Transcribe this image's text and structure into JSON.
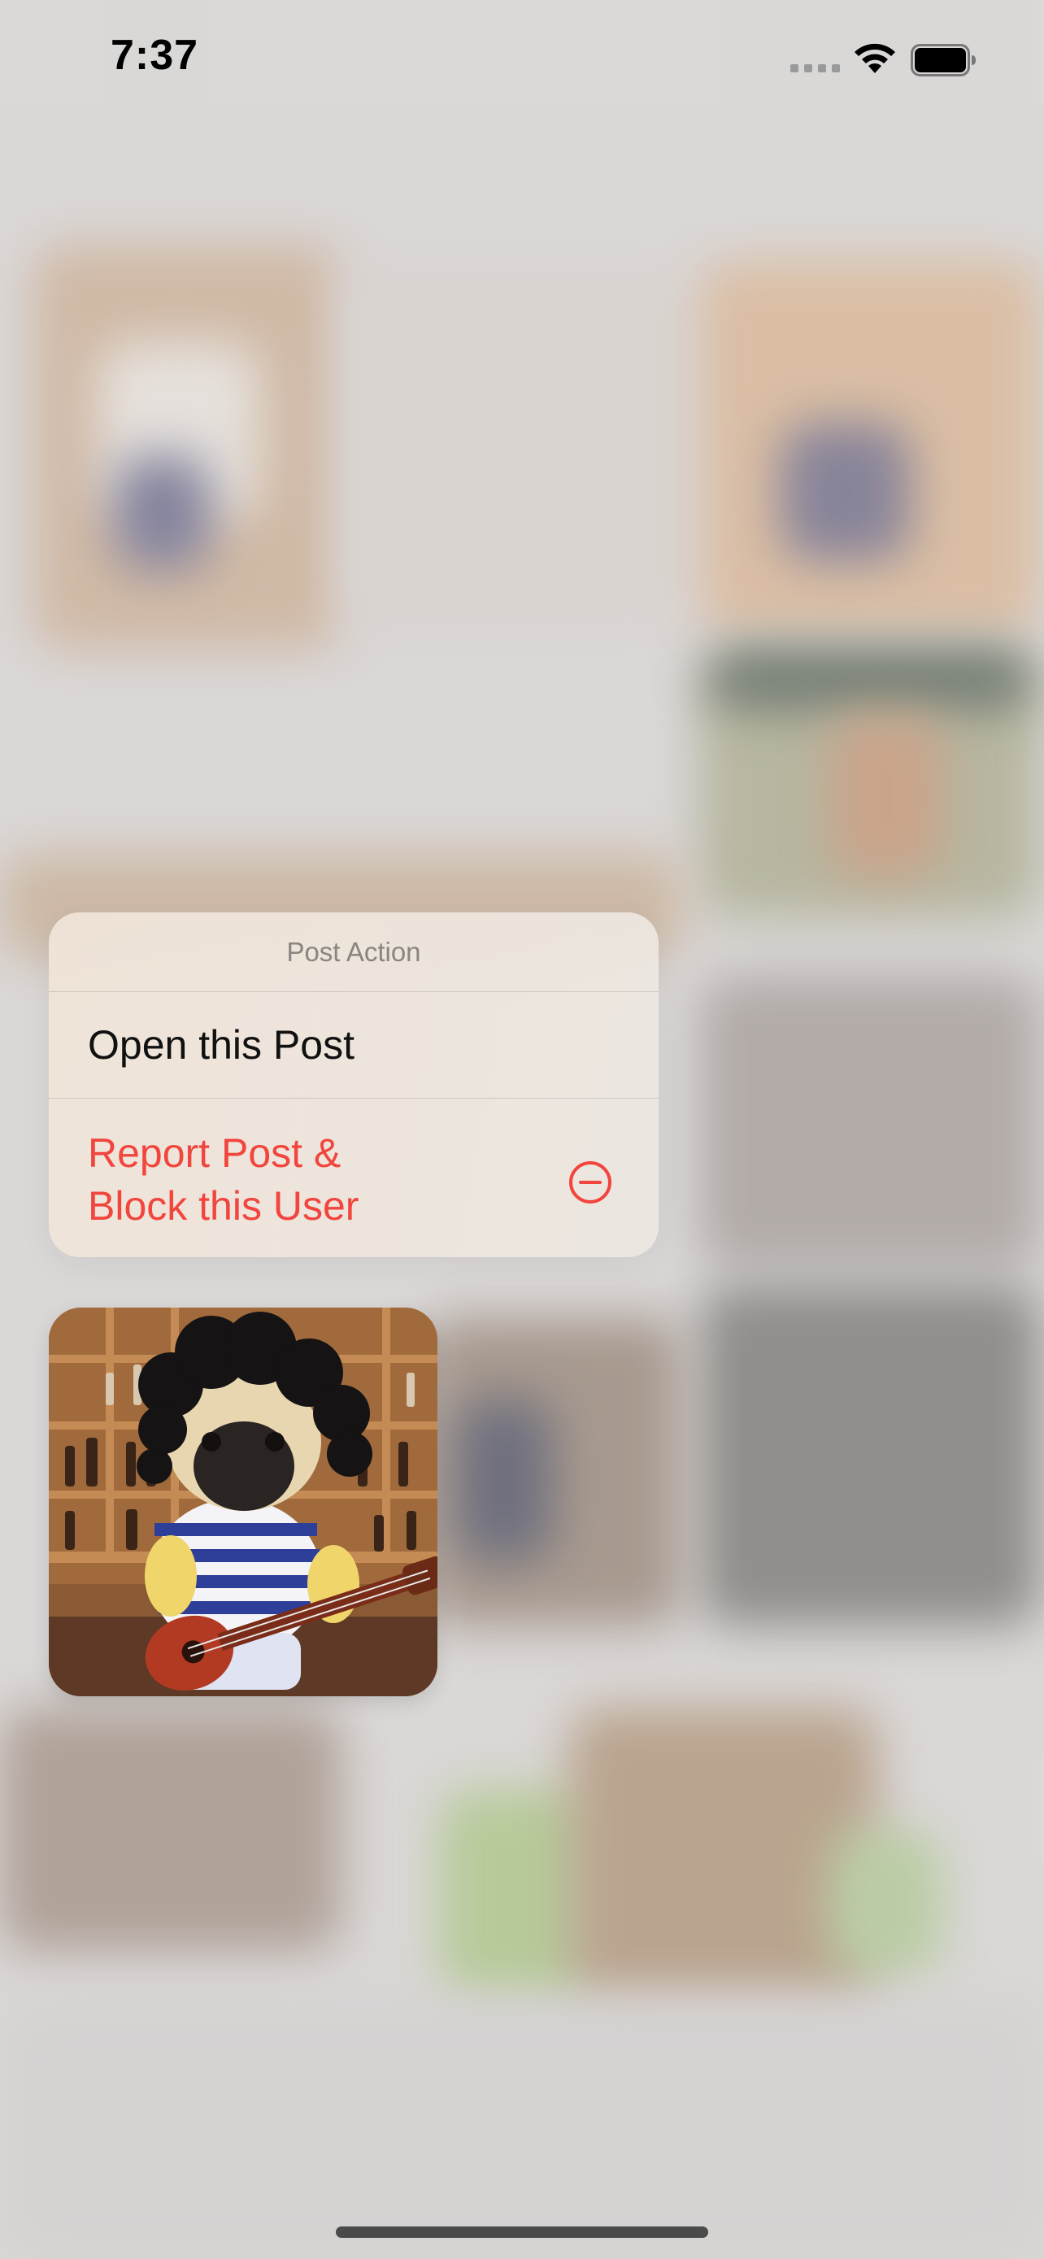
{
  "status_bar": {
    "time": "7:37",
    "signal_icon": "cellular-signal-icon",
    "wifi_icon": "wifi-icon",
    "battery_icon": "battery-full-icon"
  },
  "context_menu": {
    "title": "Post Action",
    "items": [
      {
        "label": "Open this Post"
      },
      {
        "label_line1": "Report Post &",
        "label_line2": "Block this User",
        "icon": "minus-circle-icon",
        "color": "#f1453d"
      }
    ]
  },
  "preview": {
    "subject_icon": "pug-guitar-photo"
  }
}
